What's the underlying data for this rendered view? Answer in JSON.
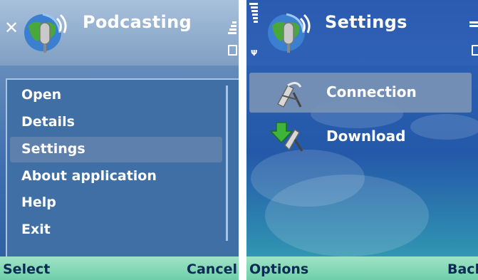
{
  "left_screen": {
    "title": "Podcasting",
    "menu": {
      "items": [
        "Open",
        "Details",
        "Settings",
        "About application",
        "Help",
        "Exit"
      ],
      "selected": "Settings"
    },
    "softkeys": {
      "left": "Select",
      "right": "Cancel"
    }
  },
  "right_screen": {
    "title": "Settings",
    "list": [
      {
        "label": "Connection",
        "icon": "connection-icon"
      },
      {
        "label": "Download",
        "icon": "download-icon"
      }
    ],
    "selected": "Connection",
    "softkeys": {
      "left": "Options",
      "right": "Back"
    }
  },
  "colors": {
    "softkey_bar": "#7fd9b8",
    "title_text": "#ffffff",
    "softkey_text": "#0b2a55"
  }
}
